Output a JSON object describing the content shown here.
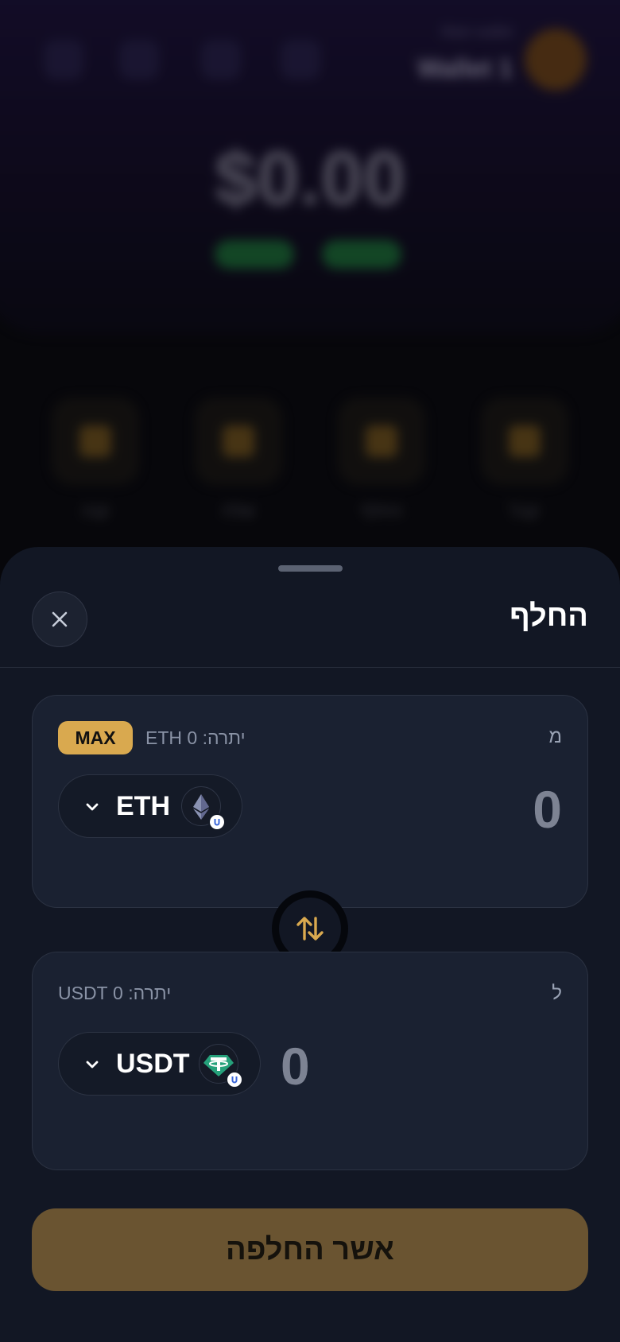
{
  "background_wallet": {
    "wallet_sub": "Main wallet",
    "wallet_name": "Wallet 1",
    "balance": "$0.00",
    "actions": [
      "קנה",
      "שלח",
      "החלף",
      "קבל"
    ]
  },
  "sheet": {
    "title": "החלף",
    "from": {
      "label": "מ",
      "balance_text": "יתרה: 0 ETH",
      "max_label": "MAX",
      "token": "ETH",
      "amount": "0"
    },
    "to": {
      "label": "ל",
      "balance_text": "יתרה: 0 USDT",
      "token": "USDT",
      "amount": "0"
    },
    "confirm_label": "אשר החלפה"
  },
  "icons": {
    "close": "close-icon",
    "chevron": "chevron-down-icon",
    "swap": "swap-arrows-icon",
    "eth": "eth-logo",
    "usdt": "usdt-logo",
    "chain": "chain-badge-icon"
  },
  "colors": {
    "sheet_bg": "#121724",
    "card_bg": "#1a2131",
    "accent": "#d9a94f",
    "confirm_bg": "#6a5431",
    "usdt": "#26a17b"
  }
}
